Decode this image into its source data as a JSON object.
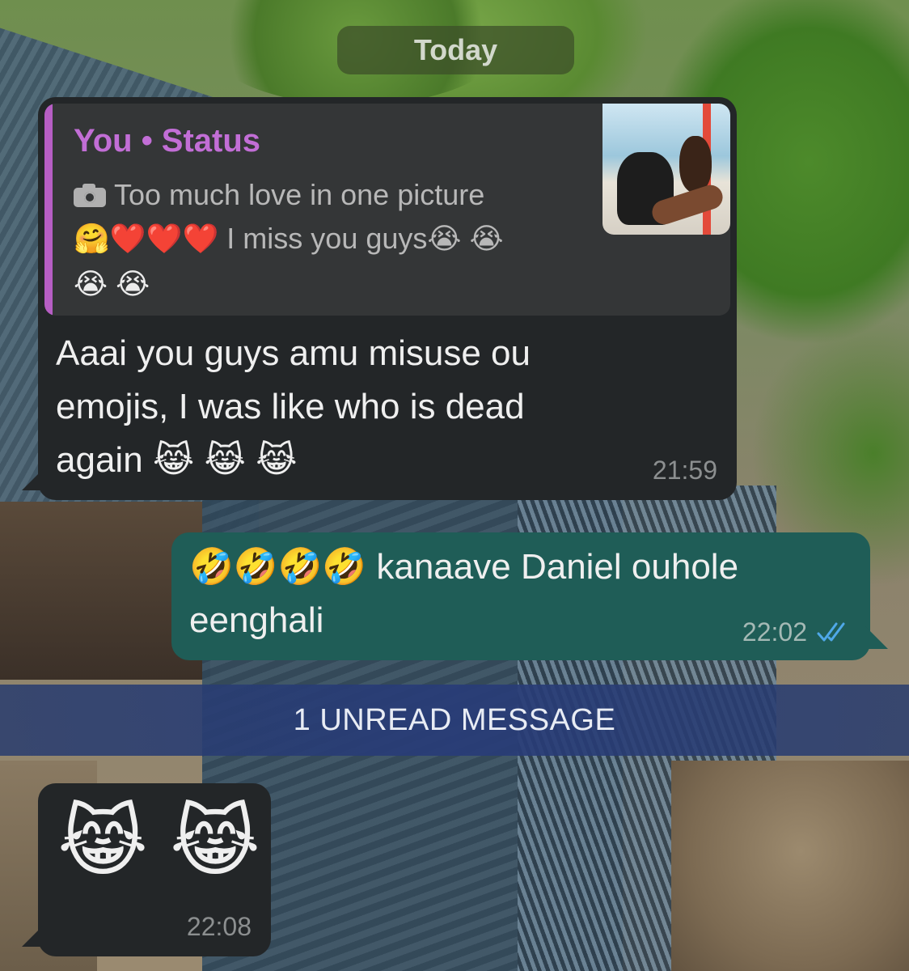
{
  "date_divider": "Today",
  "messages": [
    {
      "direction": "incoming",
      "reply_quote": {
        "title": "You • Status",
        "icon": "camera-icon",
        "text_line1": "Too much love in one picture",
        "text_line2": "🤗❤️❤️❤️ I miss you guys😭 😭",
        "text_line3": "😭 😭",
        "thumbnail": "status-photo-thumbnail"
      },
      "text_lines": [
        "Aaai you guys  amu misuse ou",
        "emojis,  I was like who is dead",
        "again 😹 😹 😹"
      ],
      "time": "21:59"
    },
    {
      "direction": "outgoing",
      "text_lines": [
        "🤣🤣🤣🤣 kanaave Daniel ouhole",
        "eenghali"
      ],
      "time": "22:02",
      "status": "read-double-tick-icon"
    },
    {
      "direction": "incoming",
      "text_lines": [
        "😹 😹"
      ],
      "time": "22:08"
    }
  ],
  "unread_divider": "1 UNREAD MESSAGE",
  "colors": {
    "incoming_bubble": "#232628",
    "outgoing_bubble": "#1f5d57",
    "quote_accent": "#b65ec4",
    "read_ticks": "#4fa8e8"
  }
}
